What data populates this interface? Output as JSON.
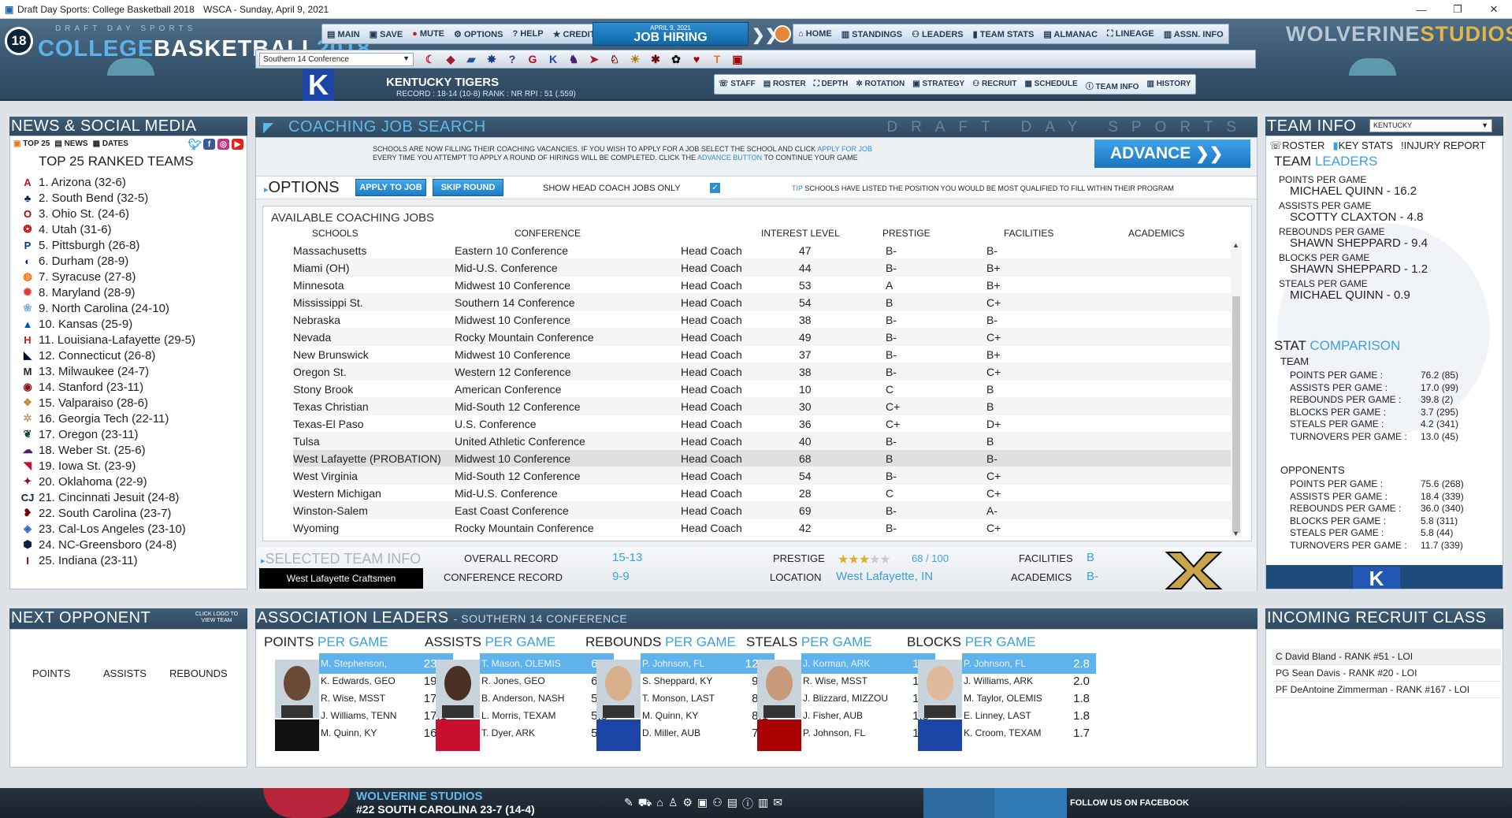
{
  "window": {
    "title": "Draft Day Sports: College Basketball 2018",
    "league_date": "WSCA - Sunday, April 9, 2021",
    "controls": [
      "—",
      "❐",
      "✕"
    ]
  },
  "header": {
    "logo_small": "DRAFT DAY SPORTS",
    "logo_college": "COLLEGE",
    "logo_basketball": "BASKETBALL",
    "logo_year": "2018",
    "logo_number": "18",
    "nav_left": [
      "MAIN",
      "SAVE",
      "MUTE",
      "OPTIONS",
      "HELP",
      "CREDITS"
    ],
    "job_date": "APRIL 9, 2021",
    "job_label": "JOB HIRING",
    "nav_right": [
      "HOME",
      "STANDINGS",
      "LEADERS",
      "TEAM STATS",
      "ALMANAC",
      "LINEAGE",
      "ASSN. INFO"
    ],
    "brand_a": "WOLVERINE",
    "brand_b": "STUDIOS",
    "conference_select": "Southern 14 Conference",
    "team_name": "KENTUCKY TIGERS",
    "team_record": "RECORD : 18-14 (10-8)   RANK : NR   RPI : 51 (.559)",
    "team_letter": "K",
    "team_nav": [
      "STAFF",
      "ROSTER",
      "DEPTH",
      "ROTATION",
      "STRATEGY",
      "RECRUIT",
      "SCHEDULE",
      "TEAM INFO",
      "HISTORY"
    ],
    "conf_logos": [
      {
        "g": "☾",
        "c": "#c8102e"
      },
      {
        "g": "◆",
        "c": "#9e1b32"
      },
      {
        "g": "▰",
        "c": "#2b4e9b"
      },
      {
        "g": "✸",
        "c": "#1e3a8a"
      },
      {
        "g": "?",
        "c": "#5a2d82"
      },
      {
        "g": "G",
        "c": "#ba0c2f"
      },
      {
        "g": "K",
        "c": "#1b46a8"
      },
      {
        "g": "♞",
        "c": "#4b1e78"
      },
      {
        "g": "➤",
        "c": "#a6192e"
      },
      {
        "g": "♘",
        "c": "#8b0000"
      },
      {
        "g": "☀",
        "c": "#b07a00"
      },
      {
        "g": "✱",
        "c": "#6d0d15"
      },
      {
        "g": "✿",
        "c": "#111111"
      },
      {
        "g": "♥",
        "c": "#a00000"
      },
      {
        "g": "T",
        "c": "#e87722"
      },
      {
        "g": "▣",
        "c": "#a00000"
      }
    ]
  },
  "news": {
    "title_a": "NEWS & ",
    "title_b": "SOCIAL MEDIA",
    "tabs": [
      "TOP 25",
      "NEWS",
      "DATES"
    ],
    "heading": "TOP 25 RANKED TEAMS",
    "teams": [
      {
        "label": "1. Arizona  (32-6)",
        "g": "A",
        "c": "#c8102e"
      },
      {
        "label": "2. South Bend  (32-5)",
        "g": "♣",
        "c": "#0c2340"
      },
      {
        "label": "3. Ohio St.  (24-6)",
        "g": "O",
        "c": "#bb0000"
      },
      {
        "label": "4. Utah  (31-6)",
        "g": "❂",
        "c": "#cc0000"
      },
      {
        "label": "5. Pittsburgh  (26-8)",
        "g": "P",
        "c": "#003594"
      },
      {
        "label": "6. Durham  (28-9)",
        "g": "◐",
        "c": "#003087"
      },
      {
        "label": "7. Syracuse  (27-8)",
        "g": "◍",
        "c": "#f76900"
      },
      {
        "label": "8. Maryland  (28-9)",
        "g": "✺",
        "c": "#e03a3e"
      },
      {
        "label": "9. North Carolina  (24-10)",
        "g": "❀",
        "c": "#7bafd4"
      },
      {
        "label": "10. Kansas  (25-9)",
        "g": "▲",
        "c": "#0051ba"
      },
      {
        "label": "11. Louisiana-Lafayette  (29-5)",
        "g": "H",
        "c": "#ce181e"
      },
      {
        "label": "12. Connecticut  (26-8)",
        "g": "◣",
        "c": "#000e2f"
      },
      {
        "label": "13. Milwaukee  (24-7)",
        "g": "M",
        "c": "#222222"
      },
      {
        "label": "14. Stanford  (23-11)",
        "g": "◉",
        "c": "#8c1515"
      },
      {
        "label": "15. Valparaiso  (28-6)",
        "g": "❖",
        "c": "#b98f2a"
      },
      {
        "label": "16. Georgia Tech  (22-11)",
        "g": "✲",
        "c": "#b3a369"
      },
      {
        "label": "17. Oregon  (23-11)",
        "g": "❦",
        "c": "#154733"
      },
      {
        "label": "18. Weber St.  (25-6)",
        "g": "☁",
        "c": "#492365"
      },
      {
        "label": "19. Iowa St.  (23-9)",
        "g": "◥",
        "c": "#c8102e"
      },
      {
        "label": "20. Oklahoma  (22-9)",
        "g": "✦",
        "c": "#841617"
      },
      {
        "label": "21. Cincinnati Jesuit  (24-8)",
        "g": "CJ",
        "c": "#0c2340"
      },
      {
        "label": "22. South Carolina  (23-7)",
        "g": "❥",
        "c": "#73000a"
      },
      {
        "label": "23. Cal-Los Angeles  (23-10)",
        "g": "◈",
        "c": "#2d68c4"
      },
      {
        "label": "24. NC-Greensboro  (24-8)",
        "g": "⬢",
        "c": "#0f2044"
      },
      {
        "label": "25. Indiana  (23-11)",
        "g": "I",
        "c": "#990000"
      }
    ]
  },
  "job_search": {
    "title": "COACHING JOB SEARCH",
    "watermark": "DRAFT DAY SPORTS",
    "notice_1": "SCHOOLS ARE NOW FILLING THEIR COACHING VACANCIES. IF YOU WISH TO APPLY FOR A JOB SELECT THE SCHOOL AND CLICK ",
    "notice_link1": "APPLY FOR JOB",
    "notice_2": "EVERY TIME YOU ATTEMPT TO APPLY A ROUND OF HIRINGS WILL BE COMPLETED. CLICK THE ",
    "notice_link2": "ADVANCE BUTTON",
    "notice_3": " TO CONTINUE YOUR GAME",
    "advance": "ADVANCE",
    "options": "OPTIONS",
    "apply": "APPLY TO JOB",
    "skip": "SKIP ROUND",
    "hc_only": "SHOW HEAD COACH JOBS ONLY",
    "tip_label": "TIP",
    "tip": " SCHOOLS HAVE LISTED THE POSITION YOU WOULD BE MOST QUALIFIED TO FILL WITHIN THEIR PROGRAM",
    "list_title": "AVAILABLE COACHING JOBS",
    "columns": [
      "SCHOOLS",
      "CONFERENCE",
      "INTEREST LEVEL",
      "PRESTIGE",
      "FACILITIES",
      "ACADEMICS"
    ],
    "jobs": [
      {
        "school": "Massachusetts",
        "conference": "Eastern 10 Conference",
        "interest": "Head Coach",
        "prestige": "47",
        "facilities": "B-",
        "academics": "B-"
      },
      {
        "school": "Miami (OH)",
        "conference": "Mid-U.S. Conference",
        "interest": "Head Coach",
        "prestige": "44",
        "facilities": "B-",
        "academics": "B+"
      },
      {
        "school": "Minnesota",
        "conference": "Midwest 10 Conference",
        "interest": "Head Coach",
        "prestige": "53",
        "facilities": "A",
        "academics": "B+"
      },
      {
        "school": "Mississippi St.",
        "conference": "Southern 14 Conference",
        "interest": "Head Coach",
        "prestige": "54",
        "facilities": "B",
        "academics": "C+"
      },
      {
        "school": "Nebraska",
        "conference": "Midwest 10 Conference",
        "interest": "Head Coach",
        "prestige": "38",
        "facilities": "B-",
        "academics": "B-"
      },
      {
        "school": "Nevada",
        "conference": "Rocky Mountain Conference",
        "interest": "Head Coach",
        "prestige": "49",
        "facilities": "B-",
        "academics": "C+"
      },
      {
        "school": "New Brunswick",
        "conference": "Midwest 10 Conference",
        "interest": "Head Coach",
        "prestige": "37",
        "facilities": "B-",
        "academics": "B+"
      },
      {
        "school": "Oregon St.",
        "conference": "Western 12 Conference",
        "interest": "Head Coach",
        "prestige": "38",
        "facilities": "B-",
        "academics": "C+"
      },
      {
        "school": "Stony Brook",
        "conference": "American Conference",
        "interest": "Head Coach",
        "prestige": "10",
        "facilities": "C",
        "academics": "B"
      },
      {
        "school": "Texas Christian",
        "conference": "Mid-South 12 Conference",
        "interest": "Head Coach",
        "prestige": "30",
        "facilities": "C+",
        "academics": "B"
      },
      {
        "school": "Texas-El Paso",
        "conference": "U.S. Conference",
        "interest": "Head Coach",
        "prestige": "36",
        "facilities": "C+",
        "academics": "D+"
      },
      {
        "school": "Tulsa",
        "conference": "United Athletic Conference",
        "interest": "Head Coach",
        "prestige": "40",
        "facilities": "B-",
        "academics": "B"
      },
      {
        "school": "West Lafayette (PROBATION)",
        "conference": "Midwest 10 Conference",
        "interest": "Head Coach",
        "prestige": "68",
        "facilities": "B",
        "academics": "B-"
      },
      {
        "school": "West Virginia",
        "conference": "Mid-South 12 Conference",
        "interest": "Head Coach",
        "prestige": "54",
        "facilities": "B-",
        "academics": "C+"
      },
      {
        "school": "Western Michigan",
        "conference": "Mid-U.S. Conference",
        "interest": "Head Coach",
        "prestige": "28",
        "facilities": "C",
        "academics": "C+"
      },
      {
        "school": "Winston-Salem",
        "conference": "East Coast Conference",
        "interest": "Head Coach",
        "prestige": "69",
        "facilities": "B-",
        "academics": "A-"
      },
      {
        "school": "Wyoming",
        "conference": "Rocky Mountain Conference",
        "interest": "Head Coach",
        "prestige": "42",
        "facilities": "B-",
        "academics": "C+"
      }
    ],
    "selected": {
      "heading": "SELECTED TEAM INFO",
      "name": "West Lafayette Craftsmen",
      "overall_label": "OVERALL RECORD",
      "overall": "15-13",
      "conf_label": "CONFERENCE RECORD",
      "conf": "9-9",
      "prestige_label": "PRESTIGE",
      "prestige": "68 / 100",
      "stars": "★★★",
      "stars_off": "★★",
      "location_label": "LOCATION",
      "location": "West Lafayette, IN",
      "facilities_label": "FACILITIES",
      "facilities": "B",
      "academics_label": "ACADEMICS",
      "academics": "B-"
    }
  },
  "team_info": {
    "title": "TEAM INFO",
    "select": "KENTUCKY",
    "tabs": [
      "ROSTER",
      "KEY STATS",
      "INJURY REPORT"
    ],
    "leaders_a": "TEAM ",
    "leaders_b": "LEADERS",
    "leaders": [
      {
        "k": "POINTS PER GAME",
        "v": "MICHAEL QUINN - 16.2"
      },
      {
        "k": "ASSISTS PER GAME",
        "v": "SCOTTY CLAXTON - 4.8"
      },
      {
        "k": "REBOUNDS PER GAME",
        "v": "SHAWN SHEPPARD - 9.4"
      },
      {
        "k": "BLOCKS PER GAME",
        "v": "SHAWN SHEPPARD - 1.2"
      },
      {
        "k": "STEALS PER GAME",
        "v": "MICHAEL QUINN - 0.9"
      }
    ],
    "cmp_a": "STAT ",
    "cmp_b": "COMPARISON",
    "team_label": "TEAM",
    "team_stats": [
      {
        "k": "POINTS PER GAME :",
        "v": "76.2 (85)"
      },
      {
        "k": "ASSISTS PER GAME :",
        "v": "17.0 (99)"
      },
      {
        "k": "REBOUNDS PER GAME :",
        "v": "39.8 (2)"
      },
      {
        "k": "BLOCKS PER GAME :",
        "v": "3.7 (295)"
      },
      {
        "k": "STEALS PER GAME :",
        "v": "4.2 (341)"
      },
      {
        "k": "TURNOVERS PER GAME :",
        "v": "13.0 (45)"
      }
    ],
    "opp_label": "OPPONENTS",
    "opp_stats": [
      {
        "k": "POINTS PER GAME :",
        "v": "75.6 (268)"
      },
      {
        "k": "ASSISTS PER GAME :",
        "v": "18.4 (339)"
      },
      {
        "k": "REBOUNDS PER GAME :",
        "v": "36.0 (340)"
      },
      {
        "k": "BLOCKS PER GAME :",
        "v": "5.8 (311)"
      },
      {
        "k": "STEALS PER GAME :",
        "v": "5.8 (44)"
      },
      {
        "k": "TURNOVERS PER GAME :",
        "v": "11.7 (339)"
      }
    ],
    "footer_letter": "K"
  },
  "next_opponent": {
    "title": "NEXT OPPONENT",
    "hint": "CLICK LOGO TO VIEW TEAM",
    "cols": [
      "POINTS",
      "ASSISTS",
      "REBOUNDS"
    ]
  },
  "assoc": {
    "title": "ASSOCIATION LEADERS",
    "sub": "- SOUTHERN 14 CONFERENCE",
    "cats": [
      {
        "a": "POINTS ",
        "b": "PER GAME",
        "rows": [
          [
            "M. Stephenson,",
            "23.4"
          ],
          [
            "K. Edwards, GEO",
            "19.1"
          ],
          [
            "R. Wise, MSST",
            "17.6"
          ],
          [
            "J. Williams, TENN",
            "17.1"
          ],
          [
            "M. Quinn, KY",
            "16.2"
          ]
        ]
      },
      {
        "a": "ASSISTS ",
        "b": "PER GAME",
        "rows": [
          [
            "T. Mason, OLEMIS",
            "6.7"
          ],
          [
            "R. Jones, GEO",
            "6.6"
          ],
          [
            "B. Anderson, NASH",
            "5.9"
          ],
          [
            "L. Morris, TEXAM",
            "5.5"
          ],
          [
            "T. Dyer, ARK",
            "5.4"
          ]
        ]
      },
      {
        "a": "REBOUNDS ",
        "b": "PER GAME",
        "rows": [
          [
            "P. Johnson, FL",
            "12.6"
          ],
          [
            "S. Sheppard, KY",
            "9.4"
          ],
          [
            "T. Monson, LAST",
            "8.3"
          ],
          [
            "M. Quinn, KY",
            "8.1"
          ],
          [
            "D. Miller, AUB",
            "7.7"
          ]
        ]
      },
      {
        "a": "STEALS ",
        "b": "PER GAME",
        "rows": [
          [
            "J. Korman, ARK",
            "1.8"
          ],
          [
            "R. Wise, MSST",
            "1.7"
          ],
          [
            "J. Blizzard, MIZZOU",
            "1.5"
          ],
          [
            "J. Fisher, AUB",
            "1.5"
          ],
          [
            "P. Johnson, FL",
            "1.5"
          ]
        ]
      },
      {
        "a": "BLOCKS ",
        "b": "PER GAME",
        "rows": [
          [
            "P. Johnson, FL",
            "2.8"
          ],
          [
            "J. Williams, ARK",
            "2.0"
          ],
          [
            "M. Taylor, OLEMIS",
            "1.8"
          ],
          [
            "E. Linney, LAST",
            "1.8"
          ],
          [
            "K. Croom, TEXAM",
            "1.7"
          ]
        ]
      }
    ]
  },
  "recruits": {
    "title": "INCOMING RECRUIT CLASS",
    "items": [
      "C David Bland - RANK #51 - LOI",
      "PG Sean Davis - RANK #20 - LOI",
      "PF DeAntoine Zimmerman - RANK #167 - LOI"
    ]
  },
  "footer": {
    "studio": "WOLVERINE STUDIOS",
    "score": "#22 SOUTH CAROLINA 23-7 (14-4)",
    "follow": "FOLLOW US ON FACEBOOK",
    "icons": [
      "✎",
      "⛟",
      "⌂",
      "♙",
      "⚙",
      "▣",
      "⚇",
      "▤",
      "ⓘ",
      "▥",
      "✉"
    ]
  }
}
